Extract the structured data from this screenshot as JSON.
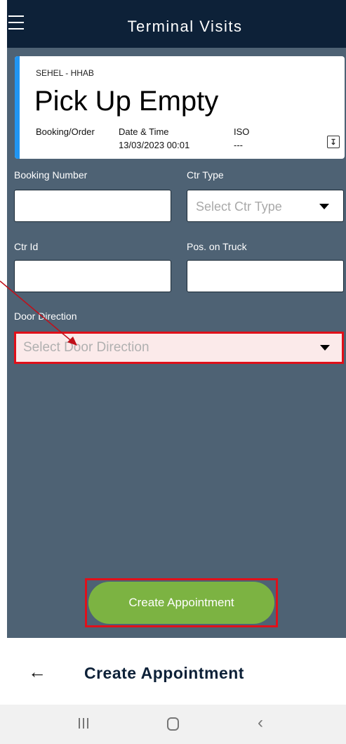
{
  "header": {
    "title": "Terminal Visits",
    "menu_icon": "hamburger-menu-icon"
  },
  "card": {
    "location": "SEHEL - HHAB",
    "title": "Pick Up Empty",
    "columns": [
      {
        "label": "Booking/Order",
        "value": ""
      },
      {
        "label": "Date & Time",
        "value": "13/03/2023 00:01"
      },
      {
        "label": "ISO",
        "value": "---"
      }
    ],
    "action_icon": "download-icon",
    "accent_color": "#2196f3"
  },
  "form": {
    "booking_number": {
      "label": "Booking Number",
      "value": ""
    },
    "ctr_type": {
      "label": "Ctr Type",
      "placeholder": "Select Ctr Type"
    },
    "ctr_id": {
      "label": "Ctr Id",
      "value": ""
    },
    "pos_on_truck": {
      "label": "Pos. on Truck",
      "value": ""
    },
    "door_direction": {
      "label": "Door Direction",
      "placeholder": "Select Door Direction"
    }
  },
  "create_button": {
    "label": "Create Appointment",
    "color": "#7cb342"
  },
  "footer": {
    "back_icon": "back-arrow-icon",
    "title": "Create Appointment"
  },
  "system_nav": {
    "recent_icon": "recent-apps-icon",
    "home_icon": "home-icon",
    "back_icon": "back-chevron-icon"
  },
  "colors": {
    "header_bg": "#0d2138",
    "app_bg": "#4e6274",
    "highlight": "#e0101a"
  }
}
